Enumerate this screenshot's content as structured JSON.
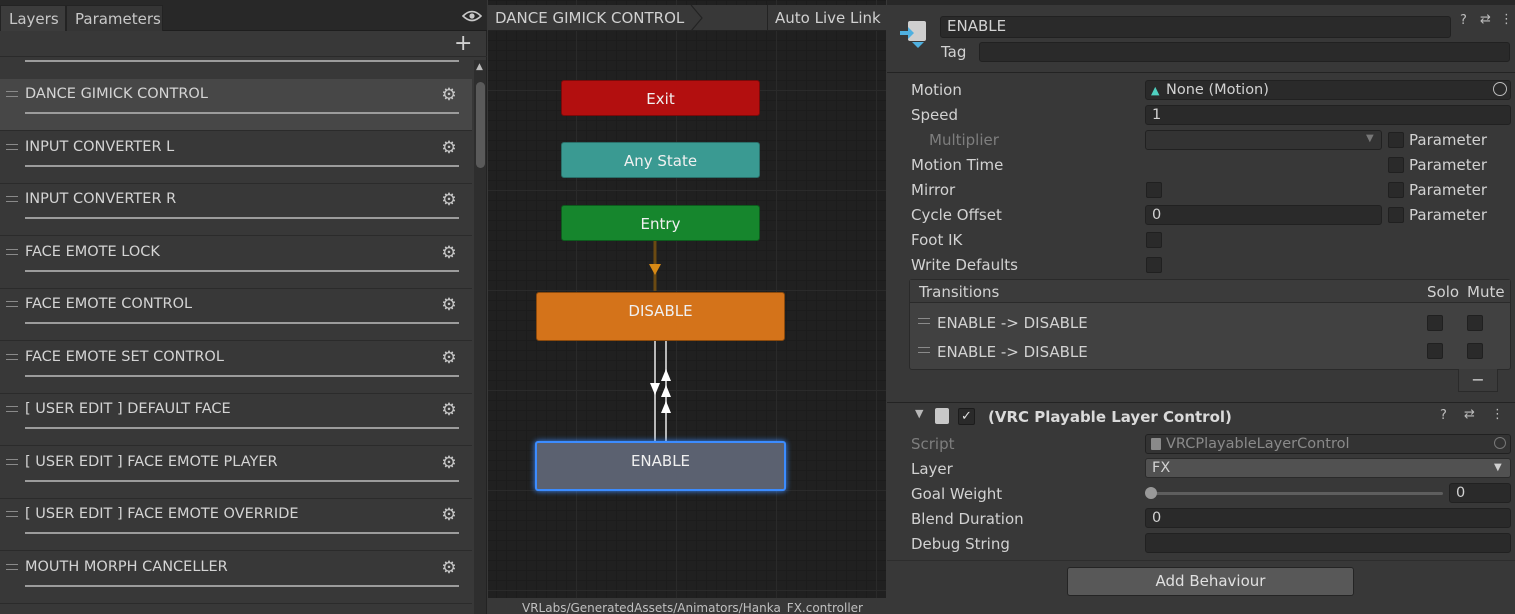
{
  "left": {
    "tabs": [
      "Layers",
      "Parameters"
    ],
    "layers": [
      "DANCE GIMICK CONTROL",
      "INPUT CONVERTER L",
      "INPUT CONVERTER R",
      "FACE EMOTE LOCK",
      "FACE EMOTE CONTROL",
      "FACE EMOTE SET CONTROL",
      "[ USER EDIT ] DEFAULT FACE",
      "[ USER EDIT ] FACE EMOTE PLAYER",
      "[ USER EDIT ] FACE EMOTE OVERRIDE",
      "MOUTH MORPH CANCELLER"
    ]
  },
  "graph": {
    "breadcrumb": "DANCE GIMICK CONTROL",
    "live_link": "Auto Live Link",
    "nodes": {
      "exit": "Exit",
      "any_state": "Any State",
      "entry": "Entry",
      "disable": "DISABLE",
      "enable": "ENABLE"
    },
    "path": "VRLabs/GeneratedAssets/Animators/Hanka_FX.controller"
  },
  "inspector": {
    "name": "ENABLE",
    "tag_label": "Tag",
    "tag_value": "",
    "motion_label": "Motion",
    "motion_value": "None (Motion)",
    "speed_label": "Speed",
    "speed_value": "1",
    "multiplier_label": "Multiplier",
    "motion_time_label": "Motion Time",
    "mirror_label": "Mirror",
    "cycle_offset_label": "Cycle Offset",
    "cycle_offset_value": "0",
    "foot_ik_label": "Foot IK",
    "write_defaults_label": "Write Defaults",
    "parameter_label": "Parameter",
    "transitions": {
      "title": "Transitions",
      "solo": "Solo",
      "mute": "Mute",
      "items": [
        "ENABLE -> DISABLE",
        "ENABLE -> DISABLE"
      ],
      "remove": "−"
    },
    "behaviour": {
      "title": "(VRC Playable Layer Control)",
      "script_label": "Script",
      "script_value": "VRCPlayableLayerControl",
      "layer_label": "Layer",
      "layer_value": "FX",
      "goal_weight_label": "Goal Weight",
      "goal_weight_value": "0",
      "blend_duration_label": "Blend Duration",
      "blend_duration_value": "0",
      "debug_string_label": "Debug String",
      "debug_string_value": ""
    },
    "add_behaviour": "Add Behaviour"
  },
  "colors": {
    "exit": "#b30f0f",
    "any_state": "#3a9a92",
    "entry": "#16862d",
    "disable": "#d4731a",
    "enable": "#5b6170",
    "selection": "#3c8cff"
  }
}
